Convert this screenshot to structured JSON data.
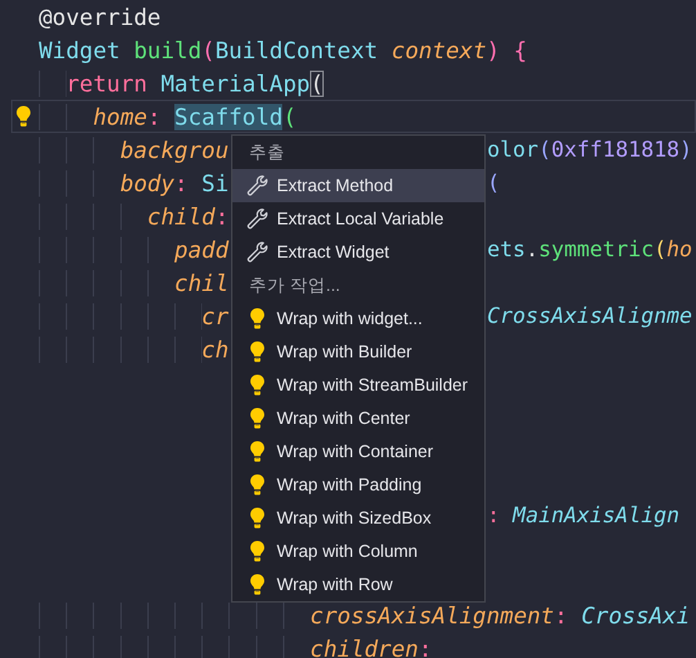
{
  "editor": {
    "lines": [
      {
        "current": false,
        "left": [
          {
            "text": "@override",
            "kind": "annotation"
          }
        ]
      },
      {
        "current": false,
        "left": [
          {
            "text": "Widget ",
            "kind": "type"
          },
          {
            "text": "build",
            "kind": "func"
          },
          {
            "text": "(",
            "kind": "bracket-pink"
          },
          {
            "text": "BuildContext ",
            "kind": "type"
          },
          {
            "text": "context",
            "kind": "param"
          },
          {
            "text": ") ",
            "kind": "bracket-pink"
          },
          {
            "text": "{",
            "kind": "bracket-pink"
          }
        ]
      },
      {
        "current": false,
        "left": [
          {
            "text": "  return ",
            "kind": "keyword"
          },
          {
            "text": "MaterialApp",
            "kind": "type"
          },
          {
            "text": "(",
            "kind": "bracket-match"
          }
        ]
      },
      {
        "current": true,
        "left": [
          {
            "text": "    home",
            "kind": "param"
          },
          {
            "text": ": ",
            "kind": "punct"
          },
          {
            "text": "Scaffold",
            "kind": "selected-type"
          },
          {
            "text": "(",
            "kind": "bracket-green"
          }
        ]
      },
      {
        "current": false,
        "left": [
          {
            "text": "      backgrou",
            "kind": "param"
          }
        ],
        "right": [
          {
            "text": "olor",
            "kind": "type"
          },
          {
            "text": "(",
            "kind": "bracket-blue"
          },
          {
            "text": "0xff181818",
            "kind": "number"
          },
          {
            "text": ")",
            "kind": "bracket-blue"
          }
        ]
      },
      {
        "current": false,
        "left": [
          {
            "text": "      body",
            "kind": "param"
          },
          {
            "text": ": ",
            "kind": "punct"
          },
          {
            "text": "Si",
            "kind": "type"
          }
        ],
        "right": [
          {
            "text": "(",
            "kind": "bracket-blue"
          }
        ]
      },
      {
        "current": false,
        "left": [
          {
            "text": "        child",
            "kind": "param"
          },
          {
            "text": ":",
            "kind": "punct"
          }
        ]
      },
      {
        "current": false,
        "left": [
          {
            "text": "          padd",
            "kind": "param"
          }
        ],
        "right": [
          {
            "text": "ets",
            "kind": "type"
          },
          {
            "text": ".",
            "kind": "plain"
          },
          {
            "text": "symmetric",
            "kind": "func"
          },
          {
            "text": "(",
            "kind": "bracket-gold"
          },
          {
            "text": "ho",
            "kind": "param"
          }
        ]
      },
      {
        "current": false,
        "left": [
          {
            "text": "          chil",
            "kind": "param"
          }
        ]
      },
      {
        "current": false,
        "left": [
          {
            "text": "            cr",
            "kind": "param"
          }
        ],
        "right": [
          {
            "text": "CrossAxisAlignme",
            "kind": "enum"
          }
        ]
      },
      {
        "current": false,
        "left": [
          {
            "text": "            ch",
            "kind": "param"
          }
        ]
      },
      {
        "current": false
      },
      {
        "current": false
      },
      {
        "current": false
      },
      {
        "current": false
      },
      {
        "current": false,
        "right": [
          {
            "text": ": ",
            "kind": "punct"
          },
          {
            "text": "MainAxisAlign",
            "kind": "enum"
          }
        ]
      },
      {
        "current": false
      },
      {
        "current": false
      },
      {
        "current": false,
        "left": [
          {
            "text": "                    crossAxisAlignment",
            "kind": "param"
          },
          {
            "text": ": ",
            "kind": "punct"
          },
          {
            "text": "CrossAxi",
            "kind": "enum"
          }
        ]
      },
      {
        "current": false,
        "left": [
          {
            "text": "                    children",
            "kind": "param"
          },
          {
            "text": ":",
            "kind": "punct"
          }
        ]
      }
    ]
  },
  "context_menu": {
    "entries": [
      {
        "kind": "header",
        "text": "추출"
      },
      {
        "kind": "extract",
        "label": "Extract Method",
        "selected": true
      },
      {
        "kind": "extract",
        "label": "Extract Local Variable",
        "selected": false
      },
      {
        "kind": "extract",
        "label": "Extract Widget",
        "selected": false
      },
      {
        "kind": "header",
        "text": "추가 작업..."
      },
      {
        "kind": "wrap",
        "label": "Wrap with widget...",
        "selected": false
      },
      {
        "kind": "wrap",
        "label": "Wrap with Builder",
        "selected": false
      },
      {
        "kind": "wrap",
        "label": "Wrap with StreamBuilder",
        "selected": false
      },
      {
        "kind": "wrap",
        "label": "Wrap with Center",
        "selected": false
      },
      {
        "kind": "wrap",
        "label": "Wrap with Container",
        "selected": false
      },
      {
        "kind": "wrap",
        "label": "Wrap with Padding",
        "selected": false
      },
      {
        "kind": "wrap",
        "label": "Wrap with SizedBox",
        "selected": false
      },
      {
        "kind": "wrap",
        "label": "Wrap with Column",
        "selected": false
      },
      {
        "kind": "wrap",
        "label": "Wrap with Row",
        "selected": false
      }
    ]
  }
}
